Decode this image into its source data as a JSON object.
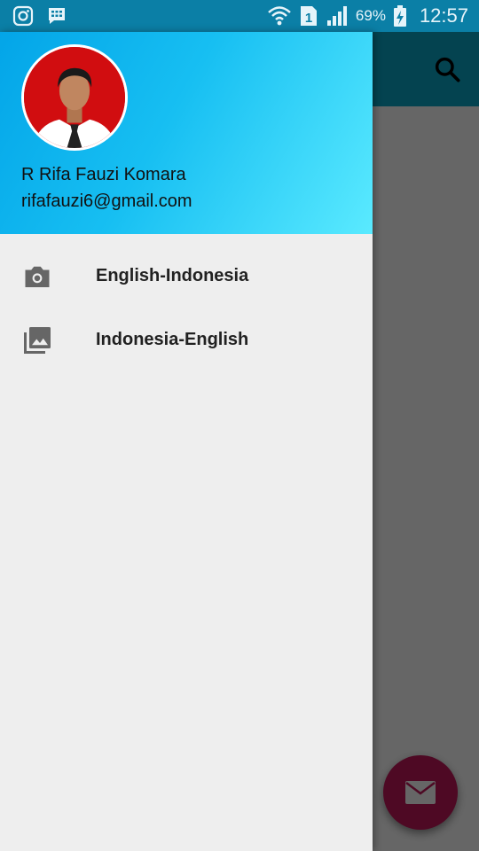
{
  "status_bar": {
    "battery_percent": "69%",
    "time": "12:57",
    "icons": [
      "instagram-icon",
      "bbm-icon",
      "wifi-icon",
      "sim-1-icon",
      "signal-icon",
      "battery-charging-icon"
    ]
  },
  "app_bar": {
    "search_icon": "search-icon"
  },
  "drawer": {
    "user": {
      "name": "R Rifa Fauzi Komara",
      "email": "rifafauzi6@gmail.com"
    },
    "items": [
      {
        "label": "English-Indonesia",
        "icon": "camera-icon"
      },
      {
        "label": "Indonesia-English",
        "icon": "photo-library-icon"
      }
    ]
  },
  "fab": {
    "icon": "mail-icon"
  },
  "colors": {
    "status_bar": "#0b7fa6",
    "toolbar": "#0aa9c9",
    "header_gradient_start": "#03a5e8",
    "header_gradient_end": "#5aeaff",
    "drawer_bg": "#eeeeee",
    "fab": "#c2185b"
  }
}
